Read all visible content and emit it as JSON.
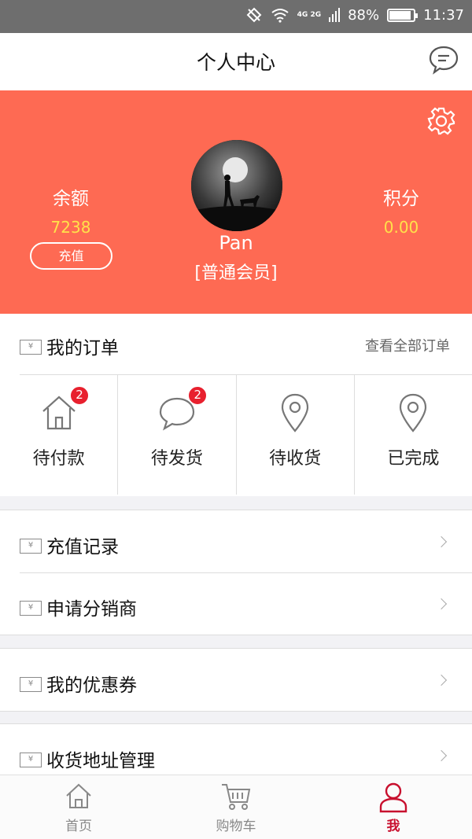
{
  "status_bar": {
    "network": "4G 2G",
    "battery": "88%",
    "battery_level": 0.88,
    "time": "11:37",
    "icons": [
      "rotate-lock-icon",
      "wifi-icon",
      "signal-icon",
      "battery-icon"
    ]
  },
  "header": {
    "title": "个人中心",
    "message_icon": "chat-bubble-icon"
  },
  "profile": {
    "balance_label": "余额",
    "balance_value": "7238",
    "recharge_button": "充值",
    "points_label": "积分",
    "points_value": "0.00",
    "username": "Pan",
    "member_level": "[普通会员]",
    "colors": {
      "background": "#fe6a53",
      "value": "#ffe14a"
    }
  },
  "orders": {
    "title": "我的订单",
    "view_all": "查看全部订单",
    "states": [
      {
        "label": "待付款",
        "icon": "house-icon",
        "badge": "2"
      },
      {
        "label": "待发货",
        "icon": "chat-bubble-icon",
        "badge": "2"
      },
      {
        "label": "待收货",
        "icon": "location-pin-icon",
        "badge": ""
      },
      {
        "label": "已完成",
        "icon": "location-pin-icon",
        "badge": ""
      }
    ]
  },
  "menu": {
    "recharge_record": "充值记录",
    "apply_distributor": "申请分销商",
    "my_coupons": "我的优惠券",
    "address_manage": "收货地址管理",
    "row_icon_text": "¥"
  },
  "tabbar": {
    "home": "首页",
    "cart": "购物车",
    "me": "我",
    "active_color": "#c8102e"
  }
}
